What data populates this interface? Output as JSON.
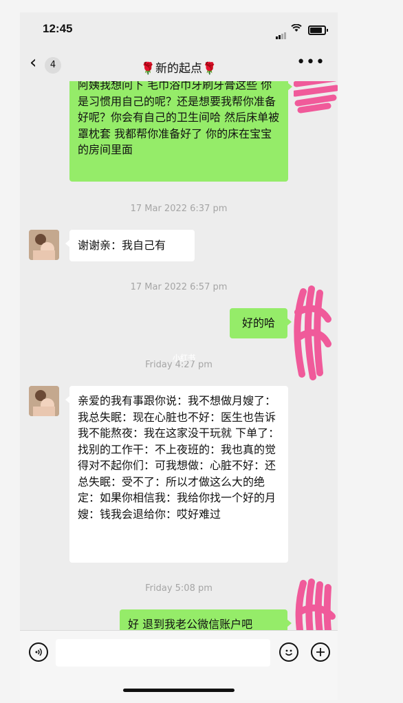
{
  "status": {
    "time": "12:45"
  },
  "nav": {
    "back_icon": "‹",
    "unread_count": "4",
    "title": "🌹新的起点🌹",
    "more_icon": "•••"
  },
  "messages": [
    {
      "side": "right",
      "text": "阿姨我想问下 毛巾浴巾牙刷牙膏这些 你是习惯用自己的呢？还是想要我帮你准备好呢？你会有自己的卫生间哈 然后床单被罩枕套 我都帮你准备好了 你的床在宝宝的房间里面"
    },
    {
      "timestamp": "17 Mar 2022 6:37 pm"
    },
    {
      "side": "left",
      "text": "谢谢亲：我自己有"
    },
    {
      "timestamp": "17 Mar 2022 6:57 pm"
    },
    {
      "side": "right",
      "text": "好的哈"
    },
    {
      "timestamp": "Friday 4:27 pm"
    },
    {
      "side": "left",
      "text": "亲爱的我有事跟你说：我不想做月嫂了：我总失眠：现在心脏也不好：医生也告诉我不能熬夜：我在这家没干玩就 下单了：找别的工作干：不上夜班的：我也真的觉得对不起你们：可我想做：心脏不好：还总失眠：受不了：所以才做这么大的绝定：如果你相信我：我给你找一个好的月嫂：钱我会退给你：哎好难过"
    },
    {
      "timestamp": "Friday 5:08 pm"
    },
    {
      "side": "right",
      "text": "好 退到我老公微信账户吧"
    }
  ],
  "watermark": "小红书",
  "input": {
    "voice_icon": "voice-icon",
    "emoji_icon": "emoji-icon",
    "plus_icon": "plus-icon"
  },
  "colors": {
    "bubble_green": "#95ec69",
    "bubble_white": "#ffffff",
    "background": "#ededed",
    "scribble": "#f05a9a"
  }
}
